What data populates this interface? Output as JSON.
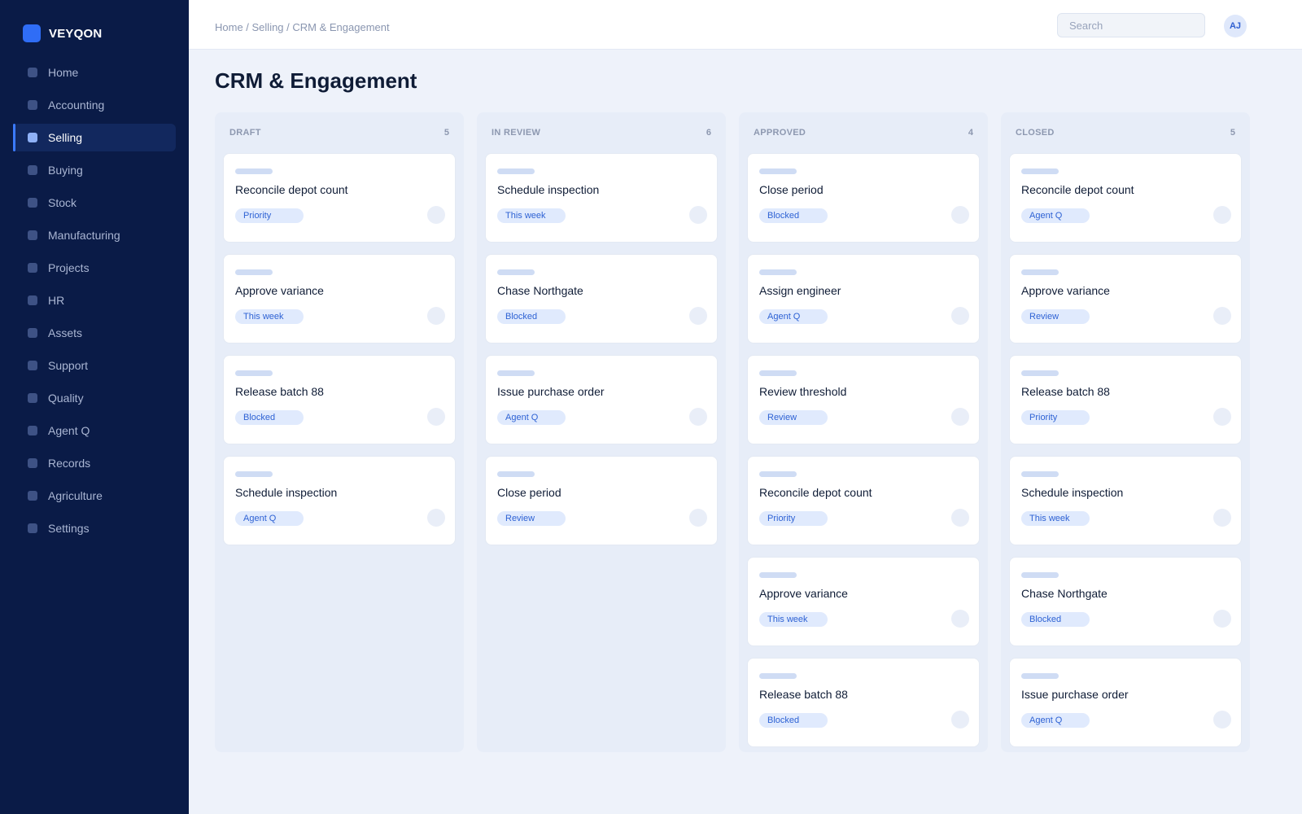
{
  "brand": {
    "name": "VEYQON",
    "accent": "#2f6df6"
  },
  "sidebar": {
    "items": [
      {
        "label": "Home",
        "active": false
      },
      {
        "label": "Accounting",
        "active": false
      },
      {
        "label": "Selling",
        "active": true
      },
      {
        "label": "Buying",
        "active": false
      },
      {
        "label": "Stock",
        "active": false
      },
      {
        "label": "Manufacturing",
        "active": false
      },
      {
        "label": "Projects",
        "active": false
      },
      {
        "label": "HR",
        "active": false
      },
      {
        "label": "Assets",
        "active": false
      },
      {
        "label": "Support",
        "active": false
      },
      {
        "label": "Quality",
        "active": false
      },
      {
        "label": "Agent Q",
        "active": false
      },
      {
        "label": "Records",
        "active": false
      },
      {
        "label": "Agriculture",
        "active": false
      },
      {
        "label": "Settings",
        "active": false
      }
    ]
  },
  "header": {
    "breadcrumb": "Home / Selling / CRM & Engagement",
    "search_placeholder": "Search",
    "avatar_initials": "AJ"
  },
  "page": {
    "title": "CRM & Engagement"
  },
  "board": {
    "columns": [
      {
        "title": "DRAFT",
        "count": "5",
        "cards": [
          {
            "title": "Reconcile depot count",
            "tag": "Priority"
          },
          {
            "title": "Approve variance",
            "tag": "This week"
          },
          {
            "title": "Release batch 88",
            "tag": "Blocked"
          },
          {
            "title": "Schedule inspection",
            "tag": "Agent Q"
          }
        ]
      },
      {
        "title": "IN REVIEW",
        "count": "6",
        "cards": [
          {
            "title": "Schedule inspection",
            "tag": "This week"
          },
          {
            "title": "Chase Northgate",
            "tag": "Blocked"
          },
          {
            "title": "Issue purchase order",
            "tag": "Agent Q"
          },
          {
            "title": "Close period",
            "tag": "Review"
          }
        ]
      },
      {
        "title": "APPROVED",
        "count": "4",
        "cards": [
          {
            "title": "Close period",
            "tag": "Blocked"
          },
          {
            "title": "Assign engineer",
            "tag": "Agent Q"
          },
          {
            "title": "Review threshold",
            "tag": "Review"
          },
          {
            "title": "Reconcile depot count",
            "tag": "Priority"
          },
          {
            "title": "Approve variance",
            "tag": "This week"
          },
          {
            "title": "Release batch 88",
            "tag": "Blocked"
          }
        ]
      },
      {
        "title": "CLOSED",
        "count": "5",
        "cards": [
          {
            "title": "Reconcile depot count",
            "tag": "Agent Q"
          },
          {
            "title": "Approve variance",
            "tag": "Review"
          },
          {
            "title": "Release batch 88",
            "tag": "Priority"
          },
          {
            "title": "Schedule inspection",
            "tag": "This week"
          },
          {
            "title": "Chase Northgate",
            "tag": "Blocked"
          },
          {
            "title": "Issue purchase order",
            "tag": "Agent Q"
          }
        ]
      }
    ]
  }
}
